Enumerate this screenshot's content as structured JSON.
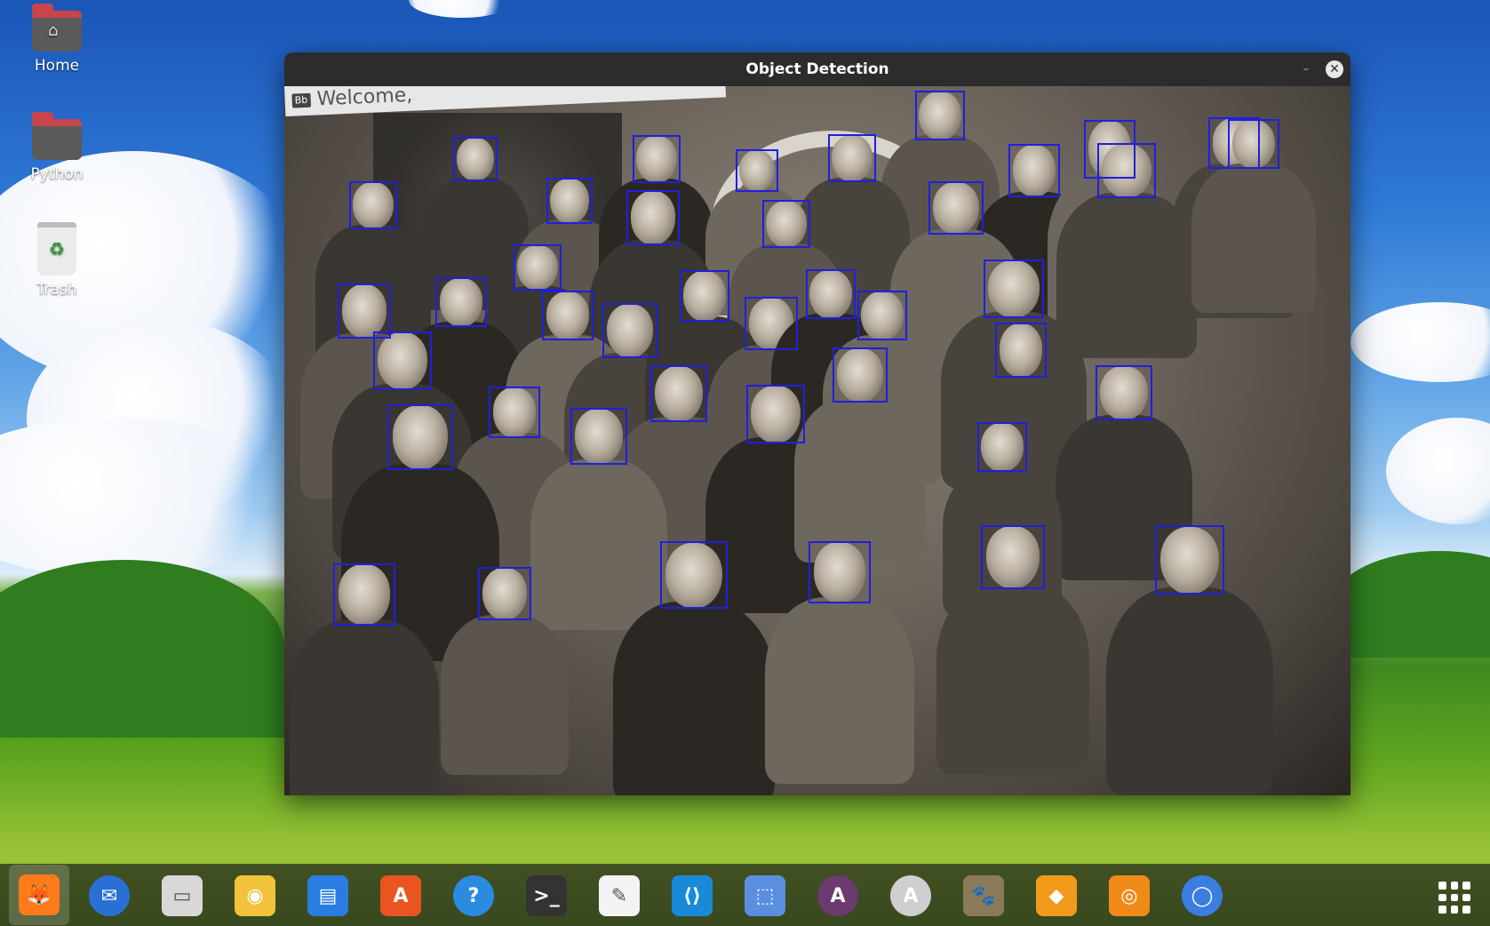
{
  "desktop": {
    "icons": [
      {
        "label": "Home",
        "icon": "home-folder-icon"
      },
      {
        "label": "Python",
        "icon": "folder-icon"
      },
      {
        "label": "Trash",
        "icon": "trash-icon"
      }
    ]
  },
  "window": {
    "title": "Object Detection",
    "minimize_glyph": "–",
    "close_glyph": "✕",
    "image": {
      "banner_text": "Welcome,",
      "banner_badge": "Bb",
      "detected_faces": 42,
      "box_color": "#1f1fe0"
    }
  },
  "taskbar": {
    "apps": [
      {
        "name": "firefox",
        "icon": "firefox-icon",
        "color": "#ff7a1a",
        "glyph": "🦊"
      },
      {
        "name": "thunderbird",
        "icon": "mail-icon",
        "color": "#2a6fd6",
        "glyph": "✉"
      },
      {
        "name": "files",
        "icon": "files-icon",
        "color": "#d8d8d8",
        "glyph": "▭"
      },
      {
        "name": "rhythmbox",
        "icon": "music-icon",
        "color": "#f2c23a",
        "glyph": "◉"
      },
      {
        "name": "writer",
        "icon": "document-icon",
        "color": "#2a7de1",
        "glyph": "▤"
      },
      {
        "name": "software",
        "icon": "software-center-icon",
        "color": "#e95420",
        "glyph": "A"
      },
      {
        "name": "help",
        "icon": "help-icon",
        "color": "#2a8ce0",
        "glyph": "?"
      },
      {
        "name": "terminal",
        "icon": "terminal-icon",
        "color": "#333333",
        "glyph": ">_"
      },
      {
        "name": "text-editor",
        "icon": "text-editor-icon",
        "color": "#f3f3f3",
        "glyph": "✎"
      },
      {
        "name": "vscode",
        "icon": "vscode-icon",
        "color": "#1a8ad8",
        "glyph": "⟨⟩"
      },
      {
        "name": "screenshot",
        "icon": "screenshot-icon",
        "color": "#5a8fe0",
        "glyph": "⬚"
      },
      {
        "name": "archive-manager",
        "icon": "archive-icon",
        "color": "#6b3a6e",
        "glyph": "A"
      },
      {
        "name": "inkscape",
        "icon": "inkscape-icon",
        "color": "#cfcfcf",
        "glyph": "A"
      },
      {
        "name": "gimp",
        "icon": "gimp-icon",
        "color": "#8a7a5a",
        "glyph": "🐾"
      },
      {
        "name": "sublime",
        "icon": "layers-icon",
        "color": "#f29a1a",
        "glyph": "◆"
      },
      {
        "name": "blender",
        "icon": "blender-icon",
        "color": "#f28a1a",
        "glyph": "◎"
      },
      {
        "name": "chromium",
        "icon": "chromium-icon",
        "color": "#3b7de0",
        "glyph": "◯"
      }
    ],
    "show_apps_icon": "app-grid-icon"
  }
}
